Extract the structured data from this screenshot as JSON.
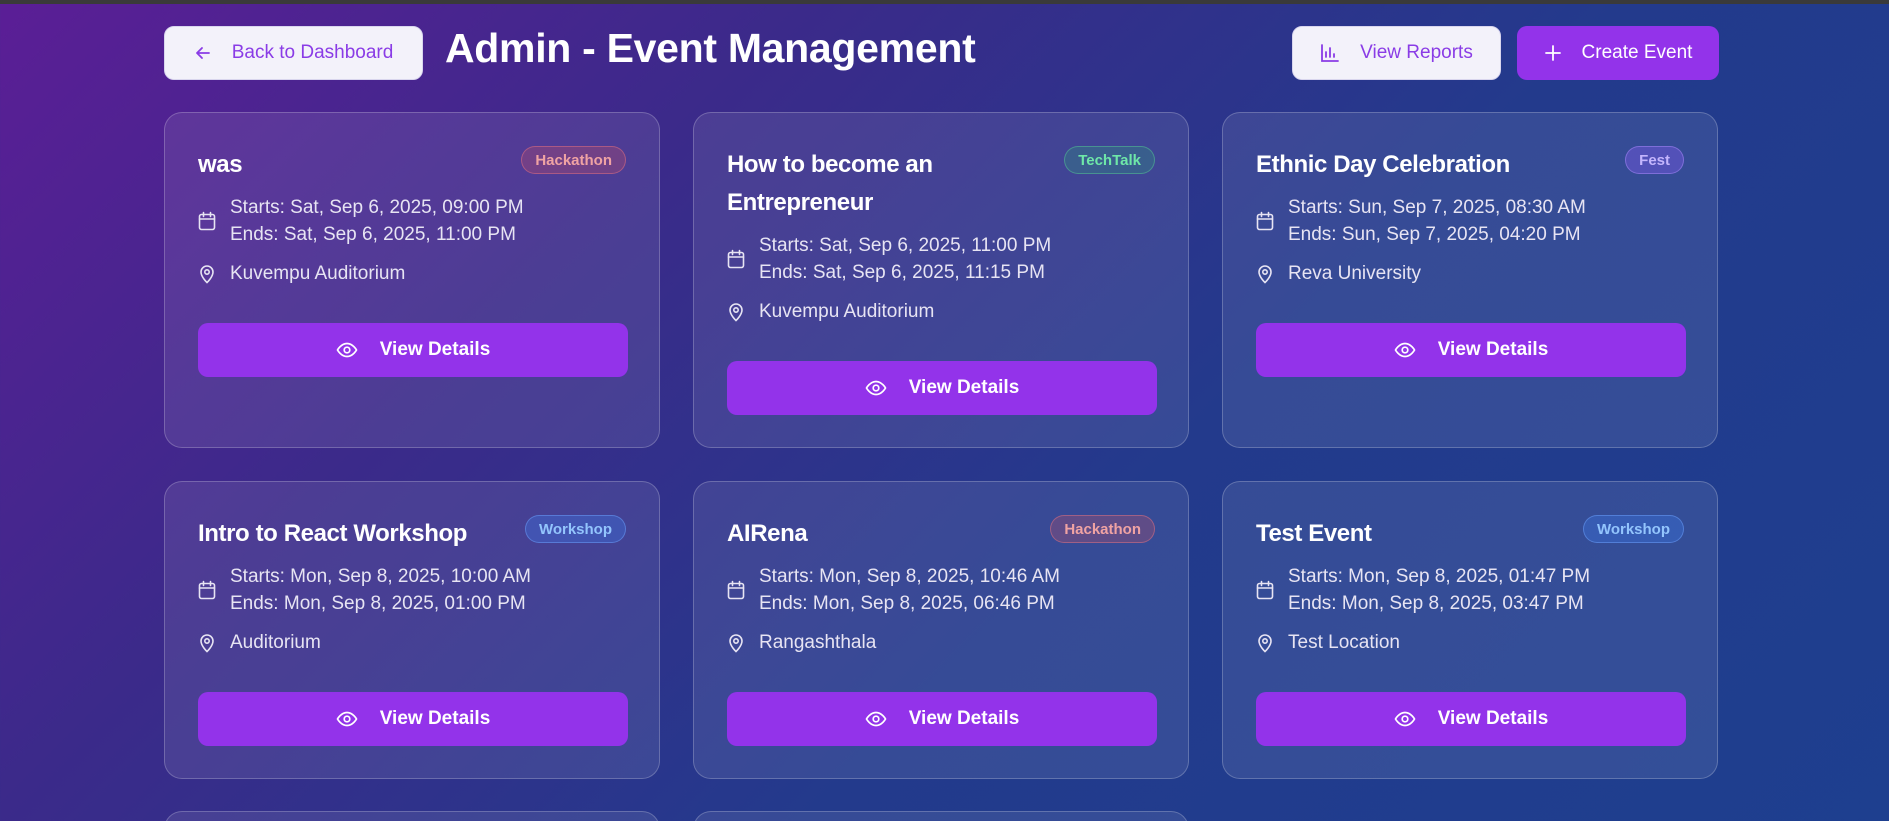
{
  "header": {
    "back_label": "Back to Dashboard",
    "title": "Admin - Event Management",
    "reports_label": "View Reports",
    "create_label": "Create Event"
  },
  "colors": {
    "accent": "#9333ea",
    "hackathon": "#f0a3a3",
    "techtalk": "#6ee7a8",
    "fest": "#c4b5fd",
    "workshop": "#93c5fd"
  },
  "events": [
    {
      "title": "was",
      "category": "Hackathon",
      "starts": "Starts: Sat, Sep 6, 2025, 09:00 PM",
      "ends": "Ends: Sat, Sep 6, 2025, 11:00 PM",
      "location": "Kuvempu Auditorium",
      "action": "View Details"
    },
    {
      "title": "How to become an Entrepreneur",
      "category": "TechTalk",
      "starts": "Starts: Sat, Sep 6, 2025, 11:00 PM",
      "ends": "Ends: Sat, Sep 6, 2025, 11:15 PM",
      "location": "Kuvempu Auditorium",
      "action": "View Details"
    },
    {
      "title": "Ethnic Day Celebration",
      "category": "Fest",
      "starts": "Starts: Sun, Sep 7, 2025, 08:30 AM",
      "ends": "Ends: Sun, Sep 7, 2025, 04:20 PM",
      "location": "Reva University",
      "action": "View Details"
    },
    {
      "title": "Intro to React Workshop",
      "category": "Workshop",
      "starts": "Starts: Mon, Sep 8, 2025, 10:00 AM",
      "ends": "Ends: Mon, Sep 8, 2025, 01:00 PM",
      "location": "Auditorium",
      "action": "View Details"
    },
    {
      "title": "AIRena",
      "category": "Hackathon",
      "starts": "Starts: Mon, Sep 8, 2025, 10:46 AM",
      "ends": "Ends: Mon, Sep 8, 2025, 06:46 PM",
      "location": "Rangashthala",
      "action": "View Details"
    },
    {
      "title": "Test Event",
      "category": "Workshop",
      "starts": "Starts: Mon, Sep 8, 2025, 01:47 PM",
      "ends": "Ends: Mon, Sep 8, 2025, 03:47 PM",
      "location": "Test Location",
      "action": "View Details"
    }
  ]
}
